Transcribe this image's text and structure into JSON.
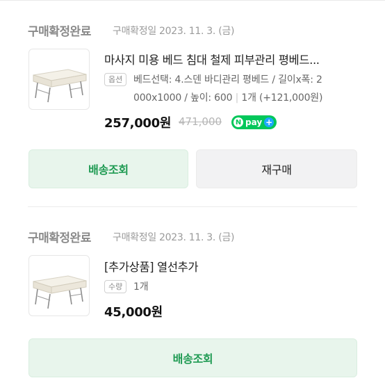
{
  "orders": [
    {
      "status": "구매확정완료",
      "date": "구매확정일 2023. 11. 3. (금)",
      "title": "마사지 미용 베드 침대 철제 피부관리 평베드...",
      "badge": "옵션",
      "option_line1": "베드선택: 4.스덴 바디관리 평베드 / 길이x폭: 2",
      "option_line2a": "000x1000 / 높이: 600",
      "option_sep": "|",
      "option_line2b": "1개 (+121,000원)",
      "price": "257,000원",
      "old_price": "471,000",
      "npay_n": "N",
      "npay_label": "pay",
      "npay_plus": "+",
      "buttons": {
        "delivery": "배송조회",
        "reorder": "재구매"
      }
    },
    {
      "status": "구매확정완료",
      "date": "구매확정일 2023. 11. 3. (금)",
      "title": "[추가상품] 열선추가",
      "badge": "수량",
      "quantity": "1개",
      "price": "45,000원",
      "buttons": {
        "delivery": "배송조회"
      }
    }
  ],
  "colors": {
    "accent_green": "#1e9a52",
    "button_green_bg": "#e8f5ec",
    "npay_green": "#03c75a",
    "npay_plus_blue": "#1ea7ff"
  },
  "icons": [
    "massage-bed-thumbnail",
    "npay-logo"
  ]
}
